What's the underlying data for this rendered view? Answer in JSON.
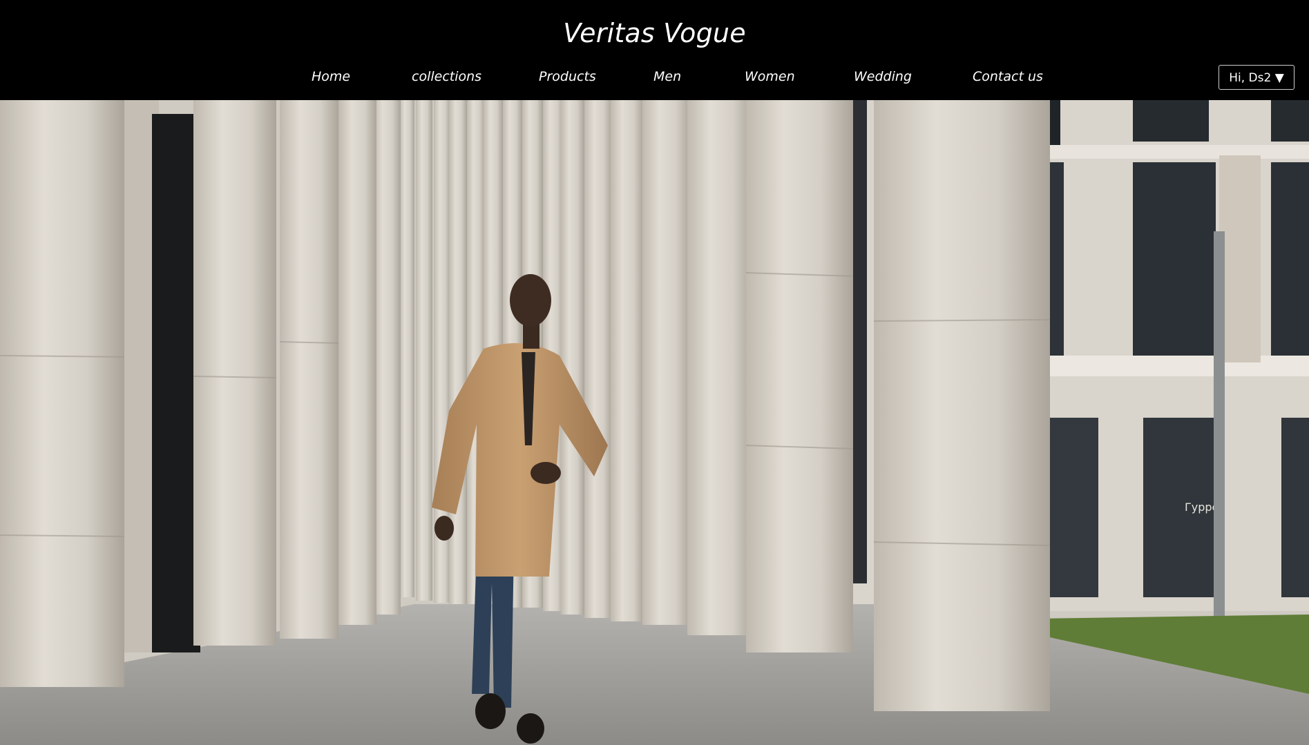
{
  "brand": {
    "title": "Veritas Vogue"
  },
  "nav": {
    "items": [
      {
        "label": "Home"
      },
      {
        "label": "collections"
      },
      {
        "label": "Products"
      },
      {
        "label": "Men"
      },
      {
        "label": "Women"
      },
      {
        "label": "Wedding"
      },
      {
        "label": "Contact us"
      }
    ]
  },
  "user": {
    "greeting": "Hi, Ds2",
    "caret": "▼"
  },
  "hero": {
    "store_sign": "Гуррег",
    "colors": {
      "coat": "#c49a6c",
      "jeans": "#2d4057",
      "stone": "#d6d1c8",
      "grass": "#5f7d36",
      "pavement": "#9a9896"
    }
  }
}
